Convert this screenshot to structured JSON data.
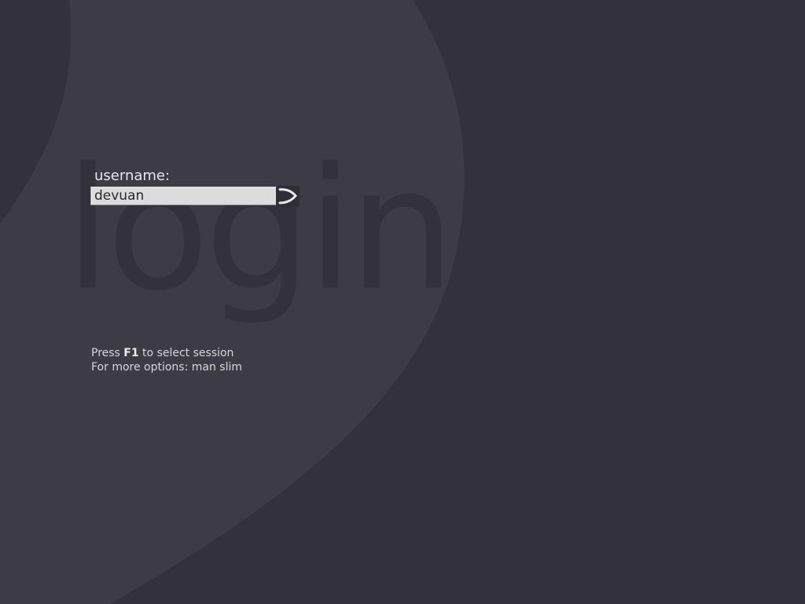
{
  "login_box": {
    "watermark": "login",
    "username_label": "username:",
    "username_value": "devuan",
    "submit_icon": "arrow-right-icon"
  },
  "help": {
    "line1_prefix": "Press ",
    "line1_key": "F1",
    "line1_suffix": " to select session",
    "line2": "For more options: man slim"
  },
  "colors": {
    "background": "#33313b",
    "swoosh": "#3d3b45",
    "field_background": "#dcdcdc",
    "label_text": "#e6e6ea"
  }
}
